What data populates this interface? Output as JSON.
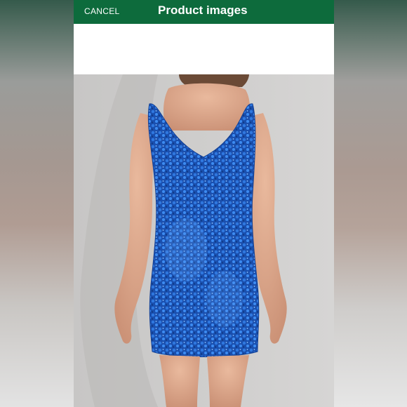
{
  "header": {
    "cancel_label": "CANCEL",
    "title": "Product images"
  },
  "colors": {
    "header_bg": "#0d6b3c",
    "dress": "#1d5cc4"
  },
  "image": {
    "subject": "dress-back-view"
  }
}
